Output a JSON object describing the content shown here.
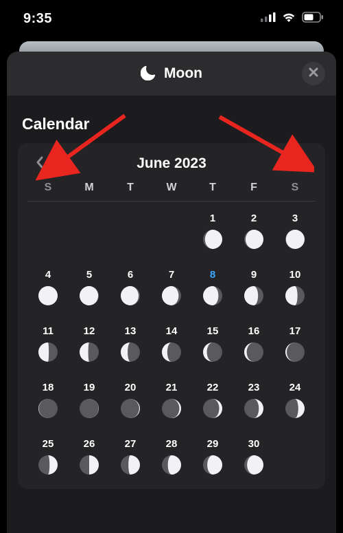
{
  "status": {
    "time": "9:35"
  },
  "sheet": {
    "title": "Moon"
  },
  "section": {
    "calendar_label": "Calendar"
  },
  "calendar": {
    "month_label": "June 2023",
    "dow": [
      "S",
      "M",
      "T",
      "W",
      "T",
      "F",
      "S"
    ],
    "today": 8,
    "blanks": 4,
    "days": [
      {
        "n": 1,
        "lit": 0.9,
        "angle": 90
      },
      {
        "n": 2,
        "lit": 0.93,
        "angle": 90
      },
      {
        "n": 3,
        "lit": 0.97,
        "angle": 90
      },
      {
        "n": 4,
        "lit": 1.0,
        "angle": 0
      },
      {
        "n": 5,
        "lit": 0.97,
        "angle": 270
      },
      {
        "n": 6,
        "lit": 0.93,
        "angle": 270
      },
      {
        "n": 7,
        "lit": 0.87,
        "angle": 270
      },
      {
        "n": 8,
        "lit": 0.8,
        "angle": 270
      },
      {
        "n": 9,
        "lit": 0.72,
        "angle": 270
      },
      {
        "n": 10,
        "lit": 0.63,
        "angle": 270
      },
      {
        "n": 11,
        "lit": 0.54,
        "angle": 270
      },
      {
        "n": 12,
        "lit": 0.45,
        "angle": 270
      },
      {
        "n": 13,
        "lit": 0.36,
        "angle": 270
      },
      {
        "n": 14,
        "lit": 0.28,
        "angle": 270
      },
      {
        "n": 15,
        "lit": 0.2,
        "angle": 270
      },
      {
        "n": 16,
        "lit": 0.13,
        "angle": 270
      },
      {
        "n": 17,
        "lit": 0.07,
        "angle": 270
      },
      {
        "n": 18,
        "lit": 0.02,
        "angle": 270
      },
      {
        "n": 19,
        "lit": 0.01,
        "angle": 90
      },
      {
        "n": 20,
        "lit": 0.04,
        "angle": 90
      },
      {
        "n": 21,
        "lit": 0.09,
        "angle": 90
      },
      {
        "n": 22,
        "lit": 0.16,
        "angle": 90
      },
      {
        "n": 23,
        "lit": 0.24,
        "angle": 90
      },
      {
        "n": 24,
        "lit": 0.33,
        "angle": 90
      },
      {
        "n": 25,
        "lit": 0.42,
        "angle": 90
      },
      {
        "n": 26,
        "lit": 0.51,
        "angle": 90
      },
      {
        "n": 27,
        "lit": 0.6,
        "angle": 90
      },
      {
        "n": 28,
        "lit": 0.69,
        "angle": 90
      },
      {
        "n": 29,
        "lit": 0.78,
        "angle": 90
      },
      {
        "n": 30,
        "lit": 0.85,
        "angle": 90
      }
    ]
  },
  "annotations": {
    "left_arrow": {
      "angle_deg": 225
    },
    "right_arrow": {
      "angle_deg": 315
    }
  },
  "colors": {
    "accent": "#3aa8ff",
    "arrow": "#e8261f",
    "moon_light": "#f2f2f4",
    "moon_dark": "#5a5a5e"
  }
}
